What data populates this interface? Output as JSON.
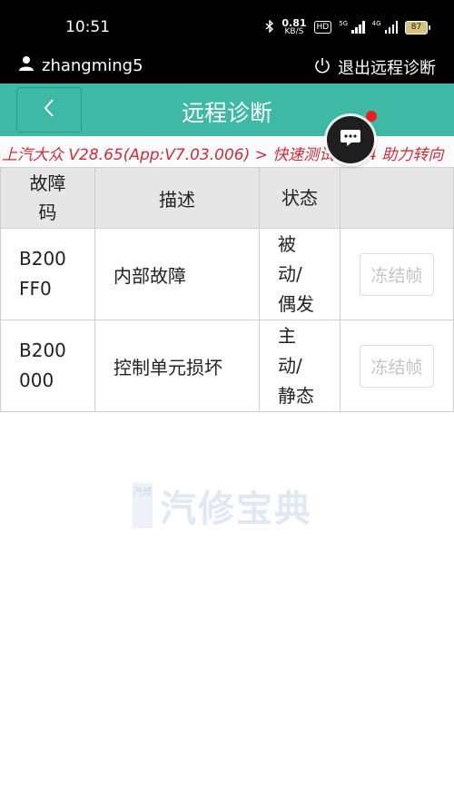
{
  "status_bar": {
    "time": "10:51",
    "net_speed_value": "0.81",
    "net_speed_unit": "KB/S",
    "hd_badge": "HD",
    "signal_1_label": "5G",
    "signal_2_label": "4G",
    "battery_level": "87"
  },
  "user_bar": {
    "username": "zhangming5",
    "exit_label": "退出远程诊断"
  },
  "header": {
    "title": "远程诊断"
  },
  "breadcrumb": {
    "text": "上汽大众 V28.65(App:V7.03.006) > 快速测试 > 44 助力转向"
  },
  "table": {
    "headers": {
      "code": "故障码",
      "description": "描述",
      "status": "状态",
      "action": ""
    },
    "rows": [
      {
        "code": "B200FF0",
        "description": "内部故障",
        "status": "被动/偶发",
        "action": "冻结帧"
      },
      {
        "code": "B200000",
        "description": "控制单元损坏",
        "status": "主动/静态",
        "action": "冻结帧"
      }
    ]
  },
  "watermark": {
    "logo_text": "汽修",
    "text": "汽修宝典"
  },
  "colors": {
    "header_bg": "#3db9a6",
    "breadcrumb_text": "#d42a3a",
    "notification_dot": "#ee1c1c"
  }
}
